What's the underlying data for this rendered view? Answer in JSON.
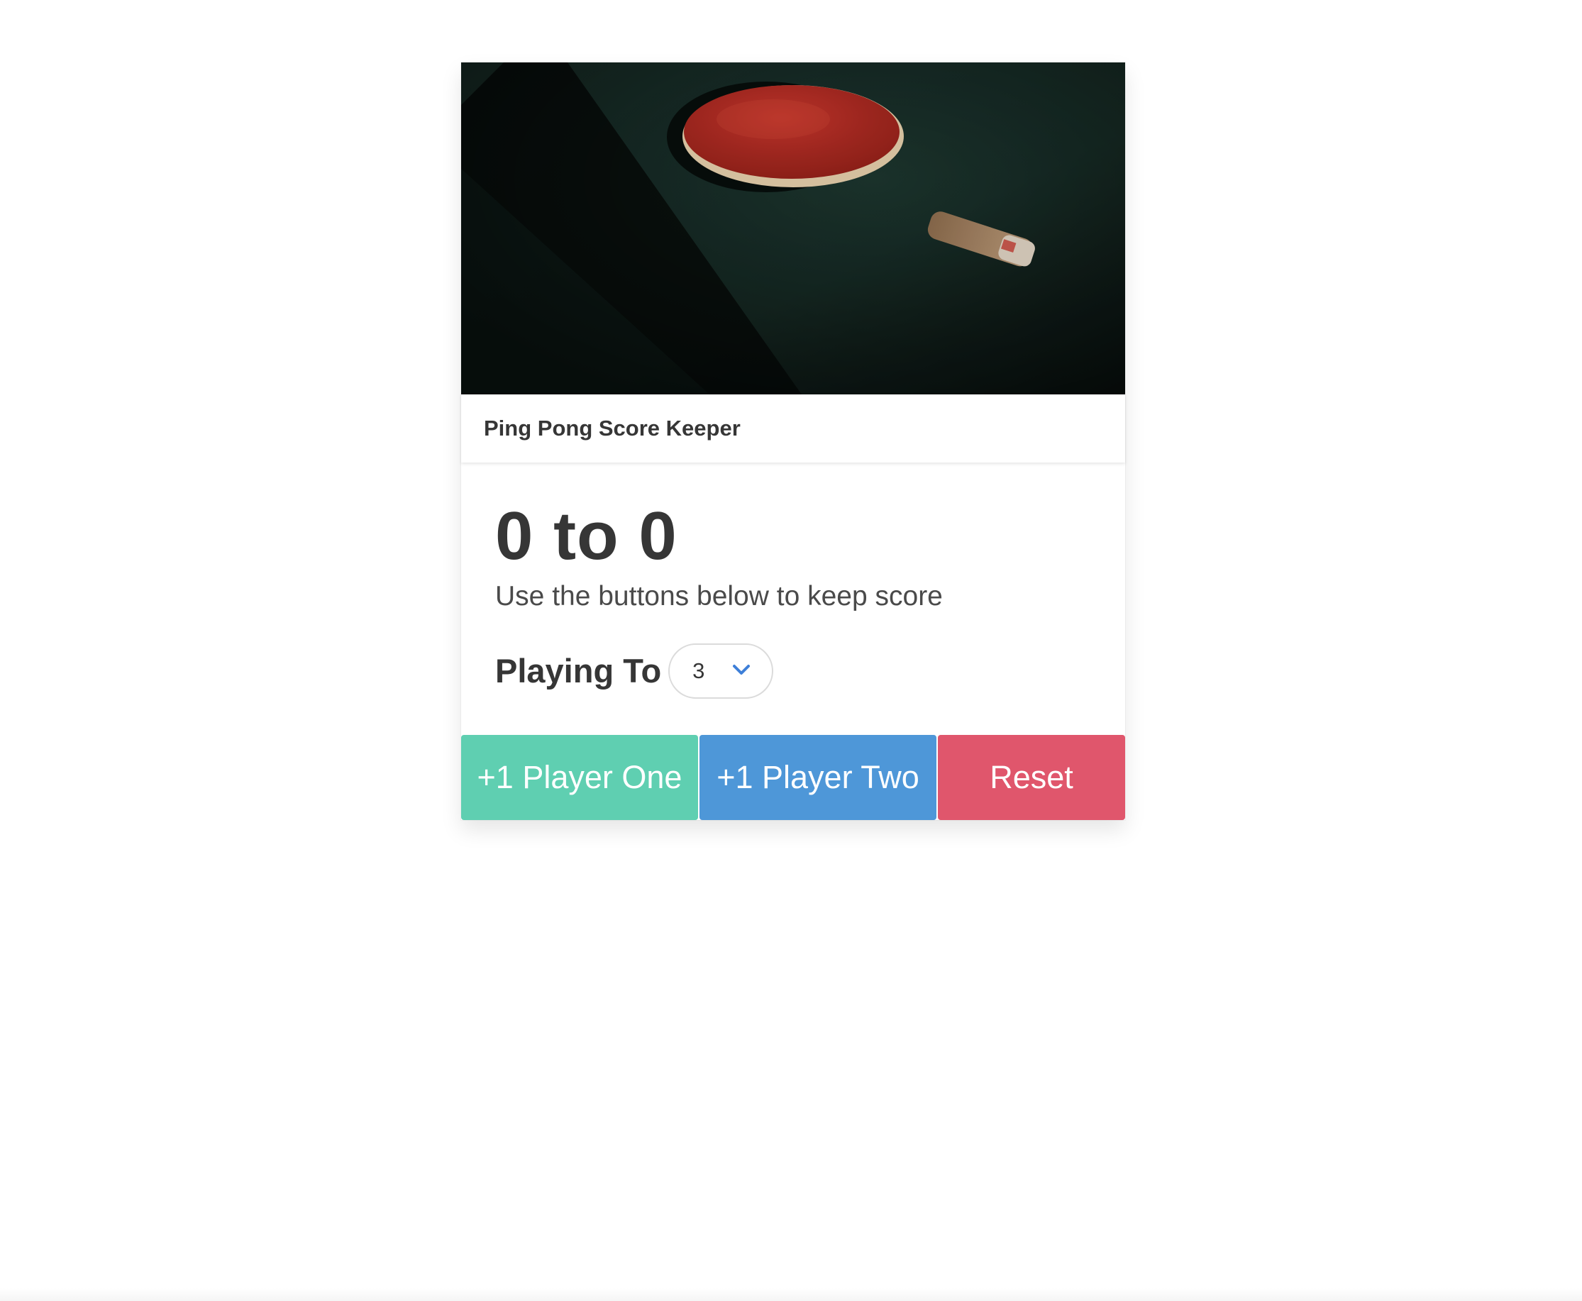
{
  "card": {
    "image_alt": "Ping pong paddle on table",
    "header_title": "Ping Pong Score Keeper"
  },
  "score": {
    "player_one": 0,
    "player_two": 0,
    "display": "0 to 0",
    "subtitle": "Use the buttons below to keep score"
  },
  "playing_to": {
    "label": "Playing To",
    "selected": "3"
  },
  "buttons": {
    "player_one": "+1 Player One",
    "player_two": "+1 Player Two",
    "reset": "Reset"
  },
  "colors": {
    "player_one": "#5fcfb1",
    "player_two": "#4e97d8",
    "reset": "#e0566c",
    "select_arrow": "#3e7fd8"
  }
}
